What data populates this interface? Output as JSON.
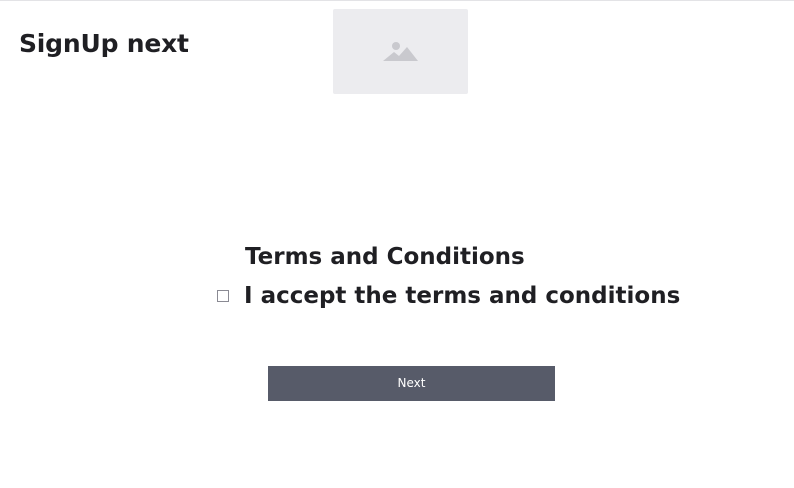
{
  "header": {
    "title": "SignUp next",
    "image_icon": "image-placeholder-icon"
  },
  "terms": {
    "heading": "Terms and Conditions",
    "checkbox_label": "I accept the terms and conditions",
    "checked": false
  },
  "actions": {
    "next_label": "Next"
  },
  "colors": {
    "button_bg": "#575b69",
    "button_text": "#ffffff",
    "placeholder_bg": "#ececef",
    "text": "#1f1f23"
  }
}
